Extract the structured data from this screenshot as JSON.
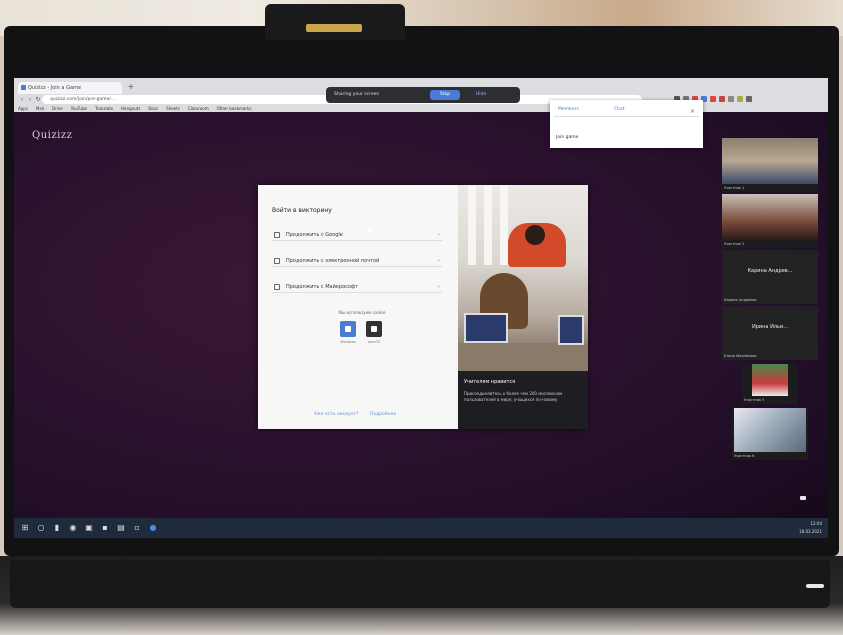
{
  "browser": {
    "tab_title": "Quizizz - Join a Game",
    "address": "quizizz.com/join/pre-game/…",
    "bookmarks": [
      "Apps",
      "Mail",
      "Drive",
      "YouTube",
      "Translate",
      "Hangouts",
      "Docs",
      "Sheets",
      "Classroom",
      "Other bookmarks"
    ]
  },
  "share_banner": {
    "text": "Sharing your screen",
    "stop_label": "Stop",
    "hide_label": "Hide"
  },
  "popup": {
    "tabs": [
      "Members",
      "Chat"
    ],
    "item": "Join game"
  },
  "app": {
    "logo": "Quizizz"
  },
  "dialog": {
    "title": "Войти в викторину",
    "options": [
      "Продолжить с Google",
      "Продолжить с электронной почтой",
      "Продолжить с Майкрософт"
    ],
    "os_label": "Мы используем cookie",
    "os_caps": [
      "Windows",
      "macOS"
    ],
    "footer_left": "Уже есть аккаунт?",
    "footer_right": "Подробнее",
    "caption_title": "Учителям нравится",
    "caption_body": "Присоединяйтесь к более чем 200 миллионам пользователей в мире, учащихся по-новому"
  },
  "participants": [
    {
      "name": "Участник 1"
    },
    {
      "name": "Участник 2"
    },
    {
      "name": "Карина Андреева",
      "label": "Карина Андрев..."
    },
    {
      "name": "Елена Михайлова",
      "label": "Ирина Ильи..."
    },
    {
      "name": "Участник 5"
    },
    {
      "name": "Участник 6"
    }
  ],
  "taskbar": {
    "time": "12:04",
    "date": "18.03.2021"
  },
  "colors": {
    "accent": "#4a7bd6",
    "desktop": "#2c1230"
  }
}
